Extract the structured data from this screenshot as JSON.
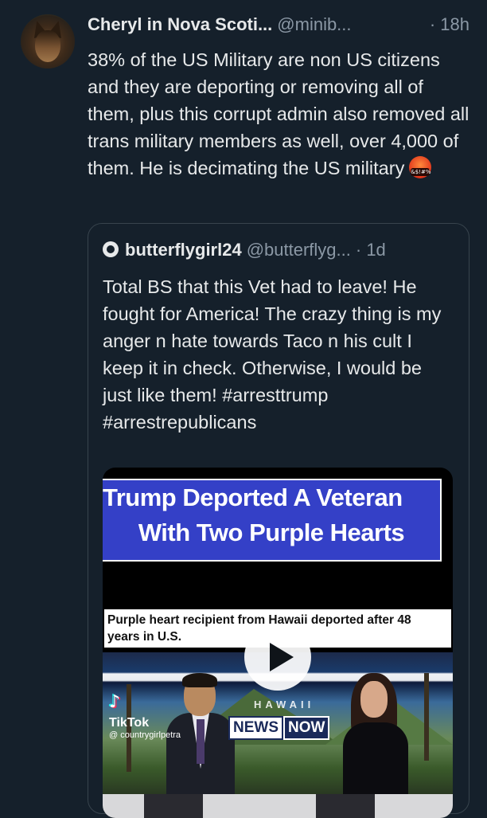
{
  "post": {
    "author_name": "Cheryl in Nova Scoti...",
    "author_handle": "@minib...",
    "time": "· 18h",
    "text": "38% of the US Military are non US citizens and they are deporting or removing all of them, plus this corrupt admin also removed all trans military members as well, over 4,000 of them. He is decimating the US military",
    "emoji_icon": "angry-cursing-face-emoji",
    "emoji_symbols": "&$!#%"
  },
  "quoted_post": {
    "author_name": "butterflygirl24",
    "author_handle": "@butterflyg...",
    "time": "· 1d",
    "text": "Total BS that this Vet had to leave! He fought for America! The crazy thing is my anger n hate towards Taco n his cult I keep it in check. Otherwise, I would be just like them! #arresttrump #arrestrepublicans",
    "video": {
      "banner_line1": "Trump Deported A Veteran",
      "banner_line2": "With Two Purple Hearts",
      "headline": "Purple heart recipient from Hawaii deported after 48 years in U.S.",
      "studio_sign": "HAWAII",
      "news_label": "NEWS",
      "now_label": "NOW",
      "watermark_brand": "TikTok",
      "watermark_user": "@ countrygirlpetra",
      "play_icon": "play-icon"
    }
  },
  "colors": {
    "background": "#15202b",
    "text": "#e7e9ea",
    "muted": "#8b98a5",
    "border": "#38444d",
    "banner": "#3440c7"
  }
}
